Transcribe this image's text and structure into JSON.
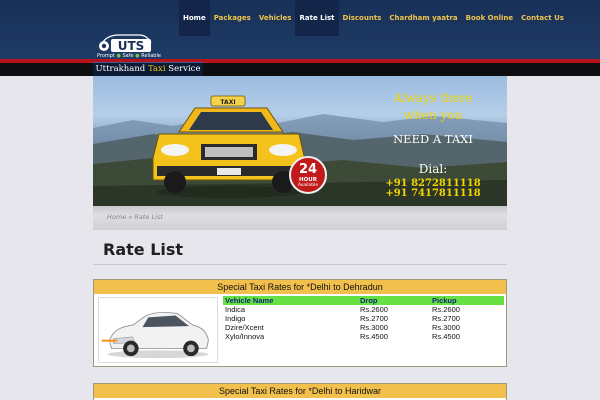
{
  "logo": {
    "badge_text": "UTS",
    "tagline": [
      "Prompt",
      "Safe",
      "Reliable"
    ],
    "banner_part1": "Uttrakhand ",
    "banner_accent": "Taxi",
    "banner_part2": " Service"
  },
  "nav": {
    "items": [
      {
        "label": "Home"
      },
      {
        "label": "Packages"
      },
      {
        "label": "Vehicles"
      },
      {
        "label": "Rate List"
      },
      {
        "label": "Discounts"
      },
      {
        "label": "Chardham yaatra"
      },
      {
        "label": "Book Online"
      },
      {
        "label": "Contact Us"
      }
    ]
  },
  "banner": {
    "line1": "Always there",
    "line2": "when you",
    "line3": "NEED A TAXI",
    "dial_label": "Dial:",
    "phone1": "+91 8272811118",
    "phone2": "+91 7417811118",
    "badge_number": "24",
    "badge_hour": "HOUR",
    "badge_available": "Available",
    "taxi_sign": "TAXI"
  },
  "breadcrumb": {
    "home": "Home",
    "separator": " » ",
    "current": "Rate List"
  },
  "page": {
    "title": "Rate List"
  },
  "rates": [
    {
      "header_prefix": "Special Taxi Rates for *Delhi ",
      "header_destination": "to Dehradun",
      "columns": [
        "Vehicle Name",
        "Drop",
        "Pickup"
      ],
      "rows": [
        [
          "Indica",
          "Rs.2600",
          "Rs.2600"
        ],
        [
          "Indigo",
          "Rs.2700",
          "Rs.2700"
        ],
        [
          "Dzire/Xcent",
          "Rs.3000",
          "Rs.3000"
        ],
        [
          "Xylo/Innova",
          "Rs.4500",
          "Rs.4500"
        ]
      ]
    },
    {
      "header_prefix": "Special Taxi Rates for *Delhi ",
      "header_destination": "to Haridwar"
    }
  ],
  "colors": {
    "header_bg": "#1f3c67",
    "nav_text": "#f1c44b",
    "rate_header_bg": "#f2c04d",
    "table_header_bg": "#66e042",
    "table_header_text": "#0d2a78",
    "red_line": "#b8121a"
  }
}
